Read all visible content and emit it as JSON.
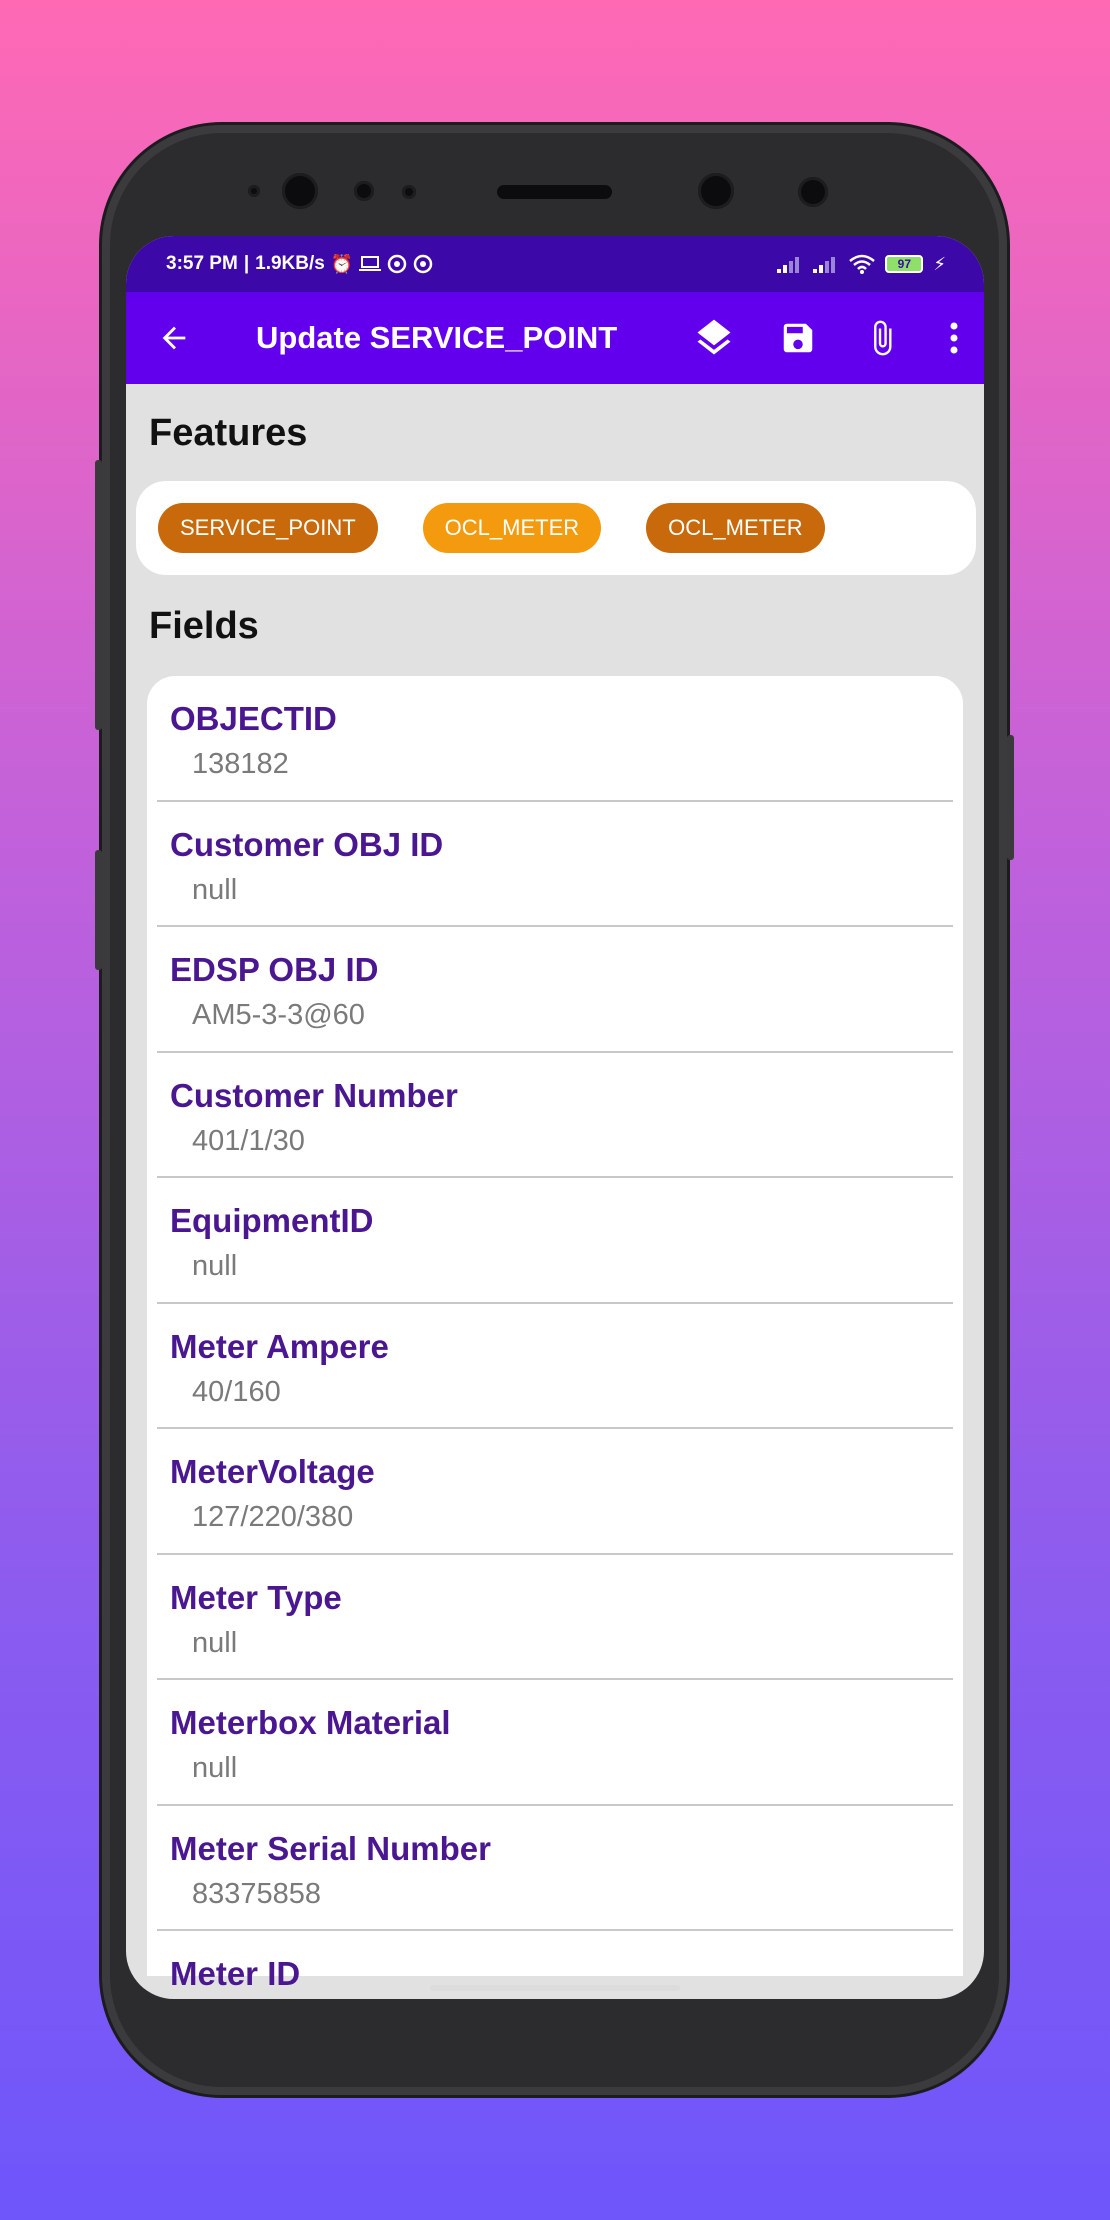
{
  "status_bar": {
    "time": "3:57 PM",
    "speed": "1.9KB/s",
    "battery": "97",
    "icons": [
      "alarm-icon",
      "laptop-icon",
      "sync-icon",
      "sync-icon",
      "signal-icon",
      "signal-icon",
      "wifi-icon",
      "battery-icon",
      "charging-icon"
    ]
  },
  "app_bar": {
    "title": "Update SERVICE_POINT",
    "actions": [
      "layers-icon",
      "save-icon",
      "attach-icon",
      "more-icon"
    ]
  },
  "features": {
    "title": "Features",
    "chips": [
      {
        "label": "SERVICE_POINT",
        "selected": false
      },
      {
        "label": "OCL_METER",
        "selected": true
      },
      {
        "label": "OCL_METER",
        "selected": false
      }
    ]
  },
  "fields": {
    "title": "Fields",
    "items": [
      {
        "label": "OBJECTID",
        "value": "138182"
      },
      {
        "label": "Customer OBJ ID",
        "value": "null"
      },
      {
        "label": "EDSP OBJ ID",
        "value": "AM5-3-3@60"
      },
      {
        "label": "Customer Number",
        "value": "401/1/30"
      },
      {
        "label": "EquipmentID",
        "value": "null"
      },
      {
        "label": "Meter Ampere",
        "value": "40/160"
      },
      {
        "label": "MeterVoltage",
        "value": "127/220/380"
      },
      {
        "label": "Meter Type",
        "value": "null"
      },
      {
        "label": "Meterbox Material",
        "value": "null"
      },
      {
        "label": "Meter Serial Number",
        "value": "83375858"
      },
      {
        "label": "Meter ID",
        "value": ""
      }
    ]
  },
  "colors": {
    "primary": "#6200ee",
    "status_bar": "#3d08a8",
    "chip": "#c8690b",
    "chip_selected": "#f39a0e",
    "field_label": "#4b1791"
  }
}
